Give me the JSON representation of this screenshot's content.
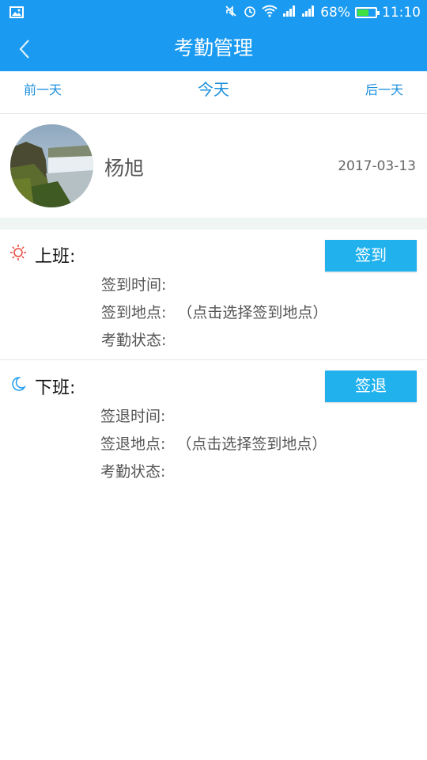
{
  "status_bar": {
    "battery_text": "68%",
    "battery_level": 0.68,
    "time": "11:10"
  },
  "header": {
    "title": "考勤管理"
  },
  "day_nav": {
    "prev": "前一天",
    "current": "今天",
    "next": "后一天"
  },
  "profile": {
    "name": "杨旭",
    "date": "2017-03-13"
  },
  "check_in": {
    "title": "上班:",
    "button": "签到",
    "time_label": "签到时间:",
    "location_label": "签到地点:",
    "location_value": "（点击选择签到地点）",
    "status_label": "考勤状态:"
  },
  "check_out": {
    "title": "下班:",
    "button": "签退",
    "time_label": "签退时间:",
    "location_label": "签退地点:",
    "location_value": "（点击选择签到地点）",
    "status_label": "考勤状态:"
  },
  "colors": {
    "primary": "#1a9af0",
    "button": "#21b2ee",
    "sun_icon": "#e8453c",
    "moon_icon": "#1a9af0"
  }
}
